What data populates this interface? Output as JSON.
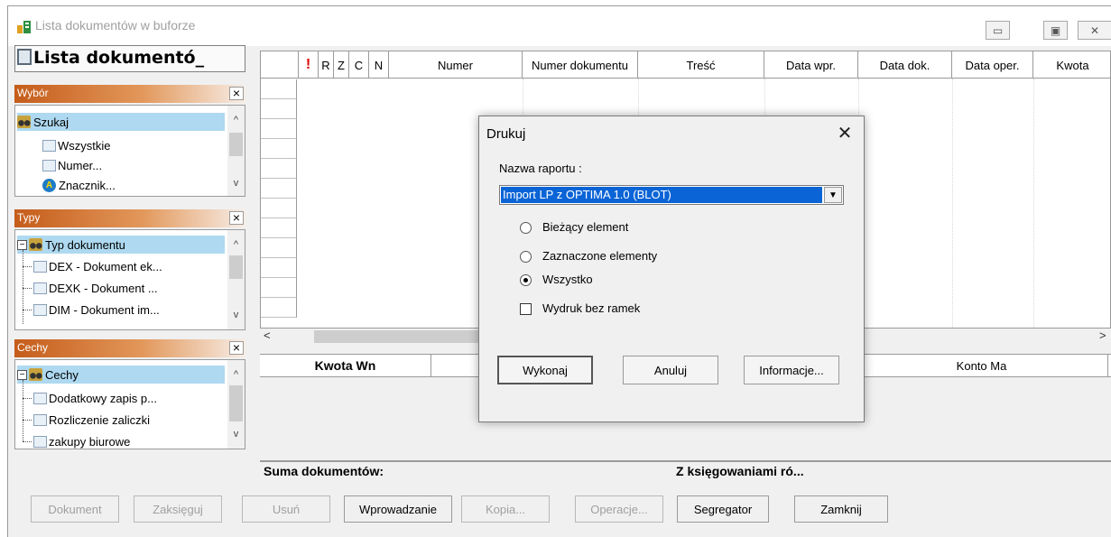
{
  "window": {
    "title": "Lista dokumentów w buforze",
    "min_glyph": "▭",
    "max_glyph": "▣",
    "close_glyph": "✕"
  },
  "left": {
    "list_title": "Lista dokumentó_",
    "close_glyph": "×",
    "wybor": {
      "title": "Wybór",
      "items": [
        "Szukaj",
        "Wszystkie",
        "Numer...",
        "Znacznik..."
      ]
    },
    "typy": {
      "title": "Typy",
      "root": "Typ dokumentu",
      "items": [
        "DEX - Dokument ek...",
        "DEXK - Dokument ...",
        "DIM - Dokument im..."
      ]
    },
    "cechy": {
      "title": "Cechy",
      "root": "Cechy",
      "items": [
        "Dodatkowy zapis p...",
        "Rozliczenie zaliczki",
        "zakupy biurowe"
      ]
    },
    "scroll": {
      "up": "^",
      "down": "v"
    }
  },
  "grid": {
    "columns": [
      "!",
      "R",
      "Z",
      "C",
      "N",
      "Numer",
      "Numer dokumentu",
      "Treść",
      "Data wpr.",
      "Data dok.",
      "Data oper.",
      "Kwota"
    ],
    "scroll_left": "<",
    "scroll_right": ">"
  },
  "sum_grid": {
    "columns": [
      "Kwota Wn",
      "",
      "",
      "",
      "Konto Ma"
    ]
  },
  "status": {
    "suma": "Suma dokumentów:",
    "ksieg": "Z księgowaniami ró..."
  },
  "buttons": {
    "dokument": "Dokument",
    "zaksieguj": "Zaksięguj",
    "usun": "Usuń",
    "wprowadzanie": "Wprowadzanie",
    "kopia": "Kopia...",
    "operacje": "Operacje...",
    "segregator": "Segregator",
    "zamknij": "Zamknij"
  },
  "dialog": {
    "title": "Drukuj",
    "close_glyph": "✕",
    "report_label": "Nazwa raportu :",
    "report_value": "Import LP z OPTIMA 1.0 (BLOT)",
    "options": [
      {
        "label": "Bieżący element",
        "selected": false
      },
      {
        "label": "Zaznaczone elementy",
        "selected": false
      },
      {
        "label": "Wszystko",
        "selected": true
      }
    ],
    "checkbox_label": "Wydruk bez ramek",
    "checkbox_checked": false,
    "buttons": {
      "execute": "Wykonaj",
      "cancel": "Anuluj",
      "info": "Informacje..."
    }
  }
}
